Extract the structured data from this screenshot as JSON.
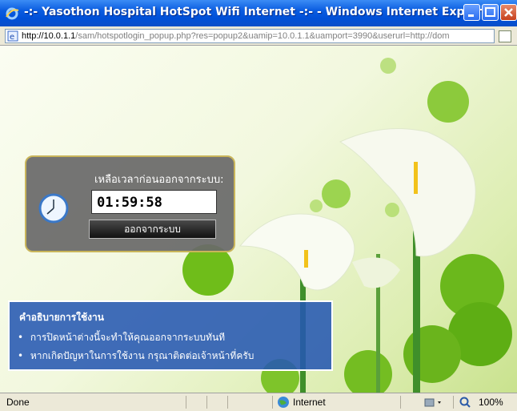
{
  "window": {
    "title": "-:- Yasothon Hospital HotSpot Wifi Internet -:- - Windows Internet Explorer"
  },
  "address": {
    "host": "http://10.0.1.1",
    "path": "/sam/hotspotlogin_popup.php?res=popup2&uamip=10.0.1.1&uamport=3990&userurl=http://dom"
  },
  "timer": {
    "label": "เหลือเวลาก่อนออกจากระบบ:",
    "value": "01:59:58",
    "logout_label": "ออกจากระบบ"
  },
  "help": {
    "title": "คำอธิบายการใช้งาน",
    "items": [
      "การปิดหน้าต่างนี้จะทำให้คุณออกจากระบบทันที",
      "หากเกิดปัญหาในการใช้งาน กรุณาติดต่อเจ้าหน้าที่ครับ"
    ]
  },
  "status": {
    "text": "Done",
    "zone": "Internet",
    "zoom": "100%"
  },
  "colors": {
    "titlebar": "#0a5ce0",
    "panel": "#6a6a6a",
    "help_panel": "#2658b2"
  }
}
